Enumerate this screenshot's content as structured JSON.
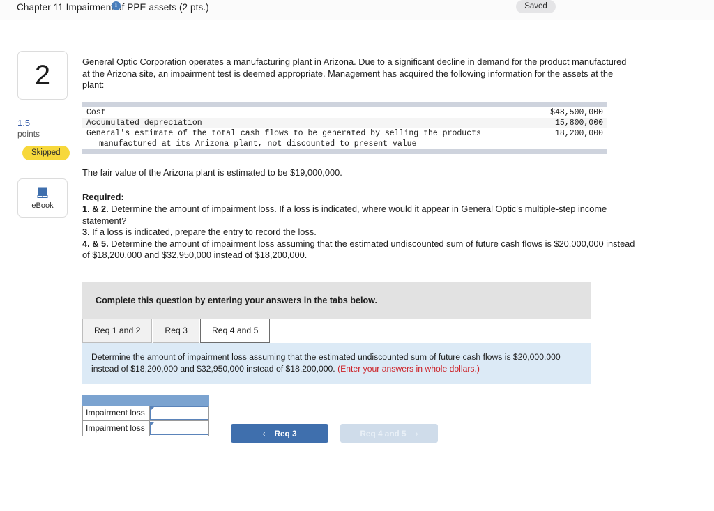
{
  "topbar": {
    "title": "Chapter 11 Impairment of PPE assets (2 pts.)",
    "info_icon": "info-icon",
    "saved_label": "Saved"
  },
  "rail": {
    "question_number": "2",
    "points_value": "1.5",
    "points_label": "points",
    "status_badge": "Skipped",
    "ebook_label": "eBook",
    "ebook_icon": "book-icon"
  },
  "main": {
    "intro_paragraph": "General Optic Corporation operates a manufacturing plant in Arizona. Due to a significant decline in demand for the product manufactured at the Arizona site, an impairment test is deemed appropriate. Management has acquired the following information for the assets at the plant:",
    "data_table": {
      "rows": [
        {
          "label": "Cost",
          "value": "$48,500,000"
        },
        {
          "label": "Accumulated depreciation",
          "value": "15,800,000"
        },
        {
          "label": "General's estimate of the total cash flows to be generated by selling the products",
          "value": "18,200,000"
        },
        {
          "label": "manufactured at its Arizona plant, not discounted to present value",
          "value": ""
        }
      ]
    },
    "fair_value_text": "The fair value of the Arizona plant is estimated to be $19,000,000.",
    "required_heading": "Required:",
    "required_items": [
      {
        "num": "1. & 2.",
        "text": " Determine the amount of impairment loss. If a loss is indicated, where would it appear in General Optic's multiple-step income statement?"
      },
      {
        "num": "3.",
        "text": " If a loss is indicated, prepare the entry to record the loss."
      },
      {
        "num": "4. & 5.",
        "text": " Determine the amount of impairment loss assuming that the estimated undiscounted sum of future cash flows is $20,000,000 instead of $18,200,000 and $32,950,000 instead of $18,200,000."
      }
    ],
    "complete_banner": "Complete this question by entering your answers in the tabs below.",
    "tabs": [
      {
        "label": "Req 1 and 2",
        "active": false
      },
      {
        "label": "Req 3",
        "active": false
      },
      {
        "label": "Req 4 and 5",
        "active": true
      }
    ],
    "instruction": {
      "text": "Determine the amount of impairment loss assuming that the estimated undiscounted sum of future cash flows is $20,000,000 instead of $18,200,000 and $32,950,000 instead of $18,200,000. ",
      "note": "(Enter your answers in whole dollars.)"
    },
    "answer_table": {
      "header_label": "",
      "rows": [
        {
          "label": "Impairment loss",
          "value": ""
        },
        {
          "label": "Impairment loss",
          "value": ""
        }
      ]
    },
    "nav": {
      "prev_label": "Req 3",
      "prev_chevron": "‹",
      "next_label": "Req 4 and 5",
      "next_chevron": "›"
    }
  },
  "colors": {
    "accent_blue": "#3f6fad",
    "badge_yellow": "#f7d83b",
    "note_red": "#cc2127",
    "panel_blue": "#dceaf6",
    "table_header_blue": "#7ba3d0"
  }
}
